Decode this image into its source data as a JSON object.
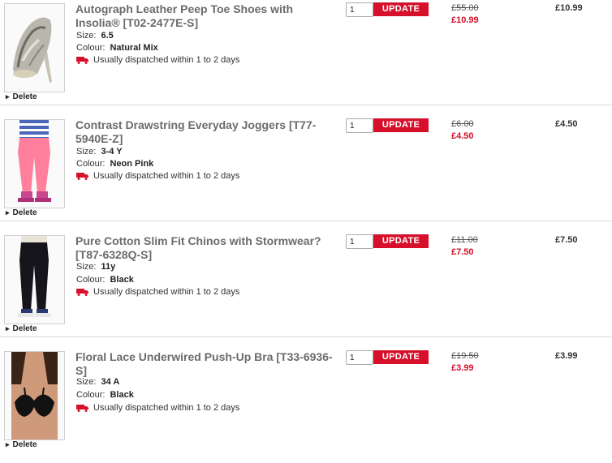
{
  "labels": {
    "size": "Size:",
    "colour": "Colour:",
    "dispatch": "Usually dispatched within 1 to 2 days",
    "update": "UPDATE",
    "delete": "Delete"
  },
  "colors": {
    "accent": "#d6102a",
    "title": "#6b6b6b",
    "divider": "#d8d8d8"
  },
  "items": [
    {
      "title": "Autograph Leather Peep Toe Shoes with Insolia® [T02-2477E-S]",
      "size": "6.5",
      "colour": "Natural Mix",
      "qty": "1",
      "was_price": "£55.00",
      "now_price": "£10.99",
      "total": "£10.99",
      "image": "snakeskin-peep-toe-shoe"
    },
    {
      "title": "Contrast Drawstring Everyday Joggers [T77-5940E-Z]",
      "size": "3-4 Y",
      "colour": "Neon Pink",
      "qty": "1",
      "was_price": "£6.00",
      "now_price": "£4.50",
      "total": "£4.50",
      "image": "child-in-pink-joggers"
    },
    {
      "title": "Pure Cotton Slim Fit Chinos with Stormwear? [T87-6328Q-S]",
      "size": "11y",
      "colour": "Black",
      "qty": "1",
      "was_price": "£11.00",
      "now_price": "£7.50",
      "total": "£7.50",
      "image": "child-in-black-chinos"
    },
    {
      "title": "Floral Lace Underwired Push-Up Bra [T33-6936-S]",
      "size": "34 A",
      "colour": "Black",
      "qty": "1",
      "was_price": "£19.50",
      "now_price": "£3.99",
      "total": "£3.99",
      "image": "model-in-black-lace-bra"
    }
  ]
}
